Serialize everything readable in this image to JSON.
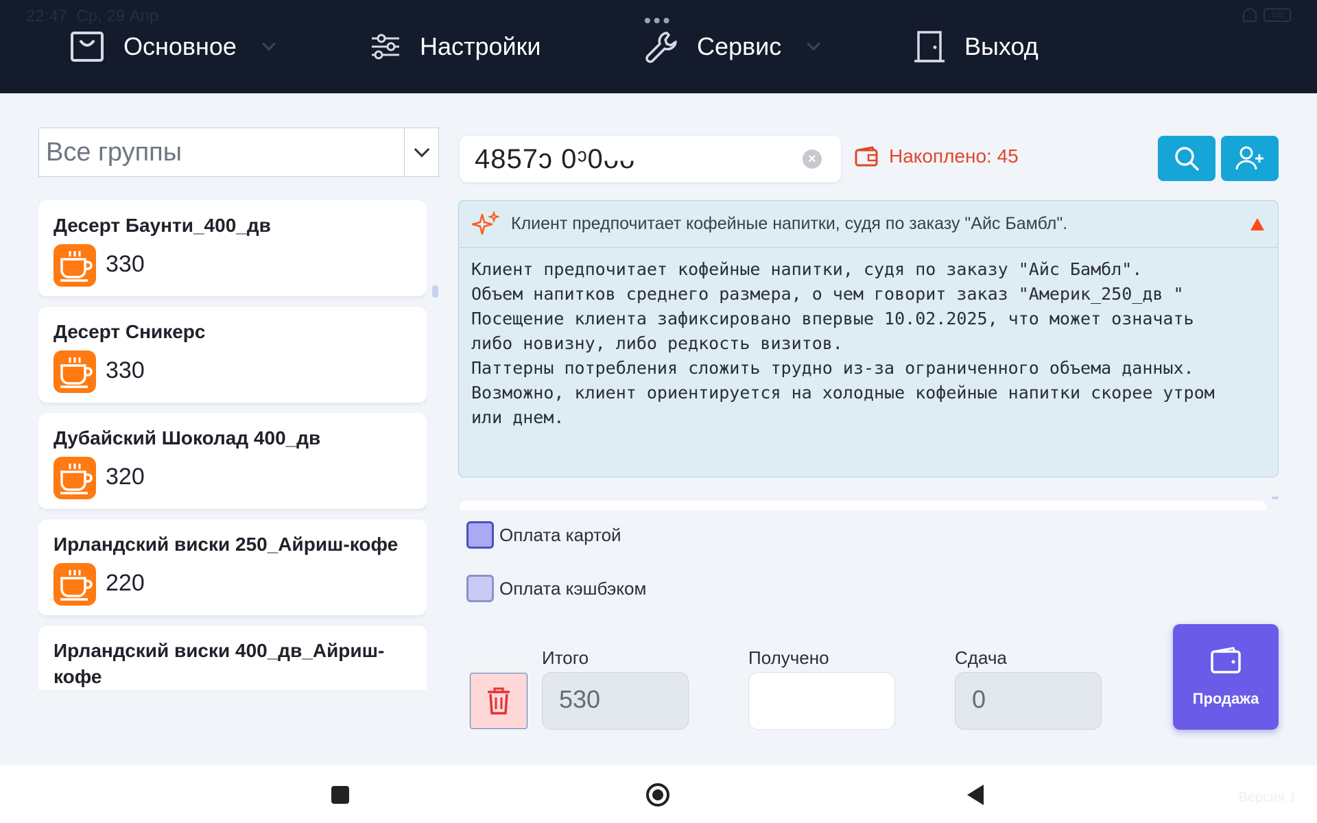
{
  "status_bar": {
    "time": "22:47",
    "date": "Ср, 29 Апр",
    "battery": "100"
  },
  "menu": {
    "items": [
      {
        "label": "Основное",
        "icon": "bag-icon"
      },
      {
        "label": "Настройки",
        "icon": "sliders-icon"
      },
      {
        "label": "Сервис",
        "icon": "wrench-icon"
      },
      {
        "label": "Выход",
        "icon": "door-icon"
      }
    ]
  },
  "group_select": {
    "value": "Все группы"
  },
  "products": [
    {
      "name": "Десерт Баунти_400_дв",
      "price": "330"
    },
    {
      "name": "Десерт Сникерс",
      "price": "330"
    },
    {
      "name": "Дубайский Шоколад 400_дв",
      "price": "320"
    },
    {
      "name": "Ирландский виски 250_Айриш-кофе",
      "price": "220"
    },
    {
      "name": "Ирландский виски 400_дв_Айриш-кофе",
      "price": ""
    }
  ],
  "customer": {
    "card_number": "4857ↄ 0ᵓ0ᴗᴗ",
    "accumulated": "Накоплено: 45"
  },
  "ai_panel": {
    "header": "Клиент предпочитает кофейные напитки, судя по заказу \"Айс Бамбл\".",
    "body": "Клиент предпочитает кофейные напитки, судя по заказу \"Айс Бамбл\".\nОбъем напитков среднего размера, о чем говорит заказ \"Америк_250_дв \"\nПосещение клиента зафиксировано впервые 10.02.2025, что может означать\nлибо новизну, либо редкость визитов.\nПаттерны потребления сложить трудно из-за ограниченного объема данных.\nВозможно, клиент ориентируется на холодные кофейные напитки скорее утром\nили днем."
  },
  "payment": {
    "card_label": "Оплата картой",
    "cashback_label": "Оплата кэшбэком"
  },
  "totals": {
    "total_label": "Итого",
    "total_value": "530",
    "received_label": "Получено",
    "received_value": "",
    "change_label": "Сдача",
    "change_value": "0"
  },
  "sale_button": {
    "label": "Продажа"
  },
  "version": "Версия 1",
  "colors": {
    "topbar": "#131b2c",
    "accent_blue": "#15a5d6",
    "accent_orange": "#ff7a12",
    "accumulated_red": "#e2462a",
    "sale_purple": "#6a5ce8",
    "checkbox_card": "#a8aaf4",
    "checkbox_cashback": "#cbcaf7"
  }
}
